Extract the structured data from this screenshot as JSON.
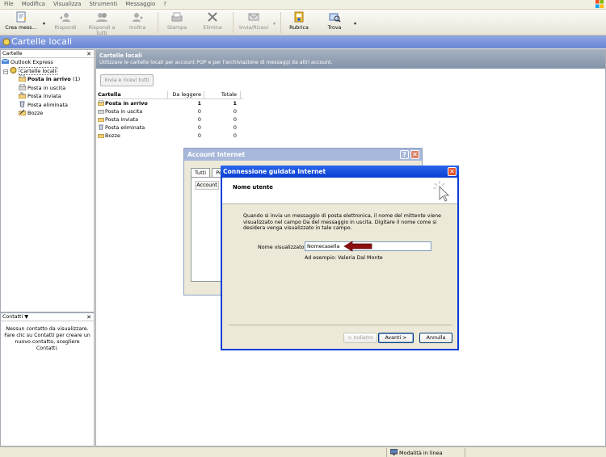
{
  "menu": [
    "File",
    "Modifica",
    "Visualizza",
    "Strumenti",
    "Messaggio",
    "?"
  ],
  "toolbar": {
    "create": "Crea mess...",
    "reply": "Rispondi",
    "reply_all": "Rispondi a tutti",
    "forward": "Inoltra",
    "print": "Stampa",
    "delete": "Elimina",
    "send_receive": "Invia/Ricevi",
    "address_book": "Rubrica",
    "find": "Trova"
  },
  "title": "Cartelle locali",
  "folders": {
    "header": "Cartelle",
    "close": "✕",
    "items": [
      {
        "label": "Outlook Express"
      },
      {
        "label": "Cartelle locali"
      },
      {
        "label": "Posta in arrivo",
        "count": "(1)"
      },
      {
        "label": "Posta in uscita"
      },
      {
        "label": "Posta inviata"
      },
      {
        "label": "Posta eliminata"
      },
      {
        "label": "Bozze"
      }
    ]
  },
  "contacts": {
    "header": "Contatti ▼",
    "close": "✕",
    "empty": "Nessun contatto da visualizzare. Fare clic su Contatti per creare un nuovo contatto, scegliere Contatti."
  },
  "banner": {
    "title": "Cartelle locali",
    "desc": "Utilizzare le cartelle locali per account POP e per l'archiviazione di messaggi da altri account."
  },
  "send_all_button": "Invia e ricevi tutti",
  "table": {
    "headers": [
      "Cartella",
      "Da leggere",
      "Totale"
    ],
    "rows": [
      {
        "name": "Posta in arrivo",
        "unread": "1",
        "total": "1"
      },
      {
        "name": "Posta in uscita",
        "unread": "0",
        "total": "0"
      },
      {
        "name": "Posta inviata",
        "unread": "0",
        "total": "0"
      },
      {
        "name": "Posta eliminata",
        "unread": "0",
        "total": "0"
      },
      {
        "name": "Bozze",
        "unread": "0",
        "total": "0"
      }
    ]
  },
  "account_dialog": {
    "title": "Account Internet",
    "help": "?",
    "close": "✕",
    "tabs": [
      "Tutti",
      "Po"
    ],
    "list_header": "Account"
  },
  "wizard": {
    "title": "Connessione guidata Internet",
    "close": "✕",
    "section": "Nome utente",
    "description": "Quando si invia un messaggio di posta elettronica, il nome del mittente viene visualizzato nel campo Da del messaggio in uscita. Digitare il nome come si desidera venga visualizzato in tale campo.",
    "field_label": "Nome visualizzato:",
    "field_value": "Nomecasella",
    "hint": "Ad esempio: Valeria Dal Monte",
    "back": "< Indietro",
    "next": "Avanti >",
    "cancel": "Annulla"
  },
  "status": "Modalità in linea",
  "colors": {
    "accent": "#0a3fd1",
    "banner": "#8c9aae",
    "arrow": "#8b0f0f"
  }
}
